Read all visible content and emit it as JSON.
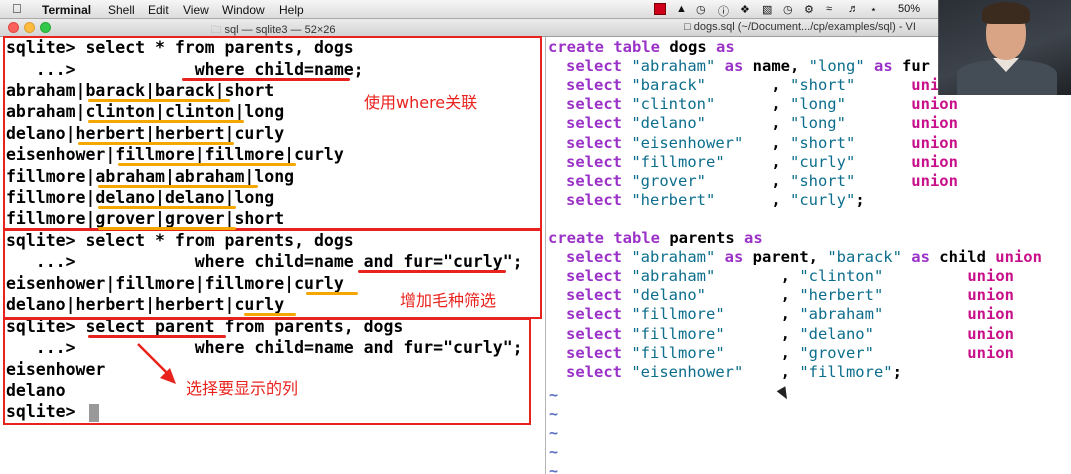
{
  "menubar": {
    "apple": "",
    "app": "Terminal",
    "items": [
      "Shell",
      "Edit",
      "View",
      "Window",
      "Help"
    ],
    "battery": "50%"
  },
  "terminal": {
    "title": "sql — sqlite3 — 52×26",
    "lines": [
      "sqlite> select * from parents, dogs",
      "   ...>            where child=name;",
      "abraham|barack|barack|short",
      "abraham|clinton|clinton|long",
      "delano|herbert|herbert|curly",
      "eisenhower|fillmore|fillmore|curly",
      "fillmore|abraham|abraham|long",
      "fillmore|delano|delano|long",
      "fillmore|grover|grover|short",
      "sqlite> select * from parents, dogs",
      "   ...>            where child=name and fur=\"curly\";",
      "eisenhower|fillmore|fillmore|curly",
      "delano|herbert|herbert|curly",
      "sqlite> select parent from parents, dogs",
      "   ...>            where child=name and fur=\"curly\";",
      "eisenhower",
      "delano",
      "sqlite> "
    ],
    "annotations": {
      "where_join": "使用where关联",
      "fur_filter": "增加毛种筛选",
      "select_column": "选择要显示的列"
    }
  },
  "vim": {
    "title": "dogs.sql (~/Document.../cp/examples/sql) - VI",
    "dogs_header": [
      "create",
      " table ",
      "dogs",
      " as"
    ],
    "dogs_rows": [
      [
        "select",
        "\"abraham\"",
        " as ",
        "name, ",
        "\"long\"",
        " as ",
        "fur"
      ],
      [
        "select",
        "\"barack\"",
        "",
        "       , ",
        "\"short\"",
        "",
        "      union"
      ],
      [
        "select",
        "\"clinton\"",
        "",
        "      , ",
        "\"long\"",
        "",
        "       union"
      ],
      [
        "select",
        "\"delano\"",
        "",
        "       , ",
        "\"long\"",
        "",
        "       union"
      ],
      [
        "select",
        "\"eisenhower\"",
        "",
        "   , ",
        "\"short\"",
        "",
        "      union"
      ],
      [
        "select",
        "\"fillmore\"",
        "",
        "     , ",
        "\"curly\"",
        "",
        "      union"
      ],
      [
        "select",
        "\"grover\"",
        "",
        "       , ",
        "\"short\"",
        "",
        "      union"
      ],
      [
        "select",
        "\"herbert\"",
        "",
        "      , ",
        "\"curly\"",
        ";",
        ""
      ]
    ],
    "parents_header": [
      "create",
      " table ",
      "parents",
      " as"
    ],
    "parents_rows": [
      [
        "select",
        "\"abraham\"",
        " as ",
        "parent, ",
        "\"barack\"",
        " as child ",
        "union"
      ],
      [
        "select",
        "\"abraham\"",
        "",
        "       , ",
        "\"clinton\"",
        "         ",
        "union"
      ],
      [
        "select",
        "\"delano\"",
        "",
        "        , ",
        "\"herbert\"",
        "         ",
        "union"
      ],
      [
        "select",
        "\"fillmore\"",
        "",
        "      , ",
        "\"abraham\"",
        "         ",
        "union"
      ],
      [
        "select",
        "\"fillmore\"",
        "",
        "      , ",
        "\"delano\"",
        "          ",
        "union"
      ],
      [
        "select",
        "\"fillmore\"",
        "",
        "      , ",
        "\"grover\"",
        "          ",
        "union"
      ],
      [
        "select",
        "\"eisenhower\"",
        "",
        "    , ",
        "\"fillmore\"",
        ";",
        ""
      ]
    ],
    "tilde": "~"
  },
  "colors": {
    "keyword": "#9b32c8",
    "string": "#0c6e8c",
    "union": "#c8108a",
    "annotation": "#e8231e",
    "highlight": "#f5a700"
  }
}
